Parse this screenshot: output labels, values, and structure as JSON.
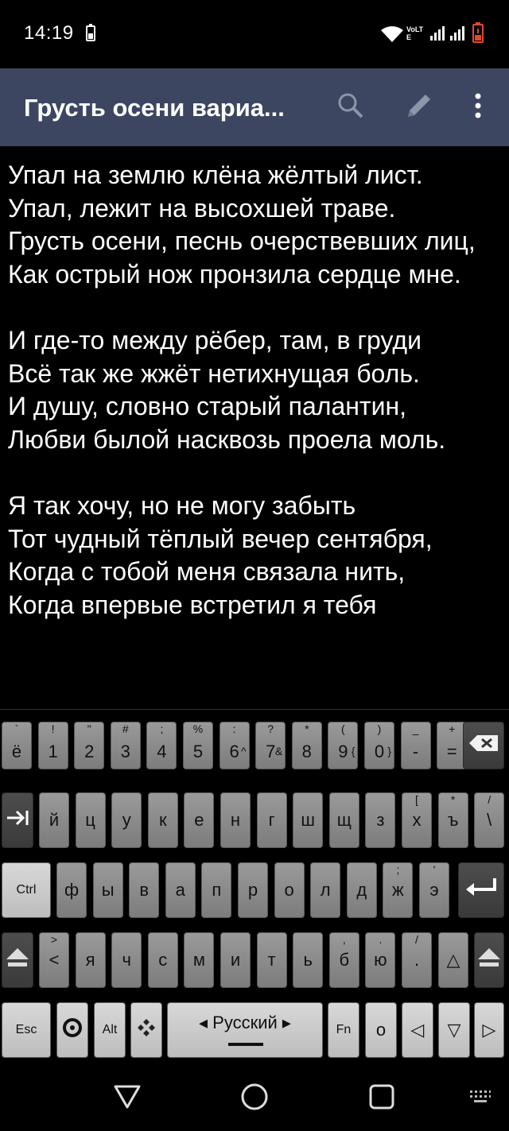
{
  "status": {
    "time": "14:19",
    "icons": [
      "battery-saver-icon",
      "wifi-icon",
      "volte-icon",
      "signal-icon",
      "signal-icon",
      "battery-low-icon"
    ],
    "volte_label": "VoLTE"
  },
  "app_bar": {
    "title": "Грусть осени вариа...",
    "actions": [
      "search-icon",
      "edit-icon",
      "more-vert-icon"
    ]
  },
  "poem": {
    "stanzas": [
      [
        "Упал на землю клёна жёлтый лист.",
        "Упал, лежит на высохшей траве.",
        "Грусть осени, песнь очерствевших лиц,",
        "Как острый нож пронзила сердце мне."
      ],
      [
        "И где-то между рёбер, там, в груди",
        "Всё так же жжёт нетихнущая боль.",
        "И душу, словно старый палантин,",
        "Любви былой насквозь проела моль."
      ],
      [
        "Я так хочу, но не могу забыть",
        "Тот чудный тёплый вечер сентября,",
        "Когда с тобой меня связала нить,",
        "Когда впервые встретил я тебя"
      ]
    ]
  },
  "keyboard": {
    "row1": [
      {
        "main": "ё",
        "hint": "`"
      },
      {
        "main": "1",
        "hint": "!"
      },
      {
        "main": "2",
        "hint": "\""
      },
      {
        "main": "3",
        "hint": "#"
      },
      {
        "main": "4",
        "hint": ";"
      },
      {
        "main": "5",
        "hint": "%"
      },
      {
        "main": "6",
        "hint": ":",
        "hint2": "^"
      },
      {
        "main": "7",
        "hint": "?",
        "hint2": "&"
      },
      {
        "main": "8",
        "hint": "*"
      },
      {
        "main": "9",
        "hint": "(",
        "hint2": "{"
      },
      {
        "main": "0",
        "hint": ")",
        "hint2": "}"
      },
      {
        "main": "-",
        "hint": "_"
      },
      {
        "main": "=",
        "hint": "+"
      }
    ],
    "row2": [
      "й",
      "ц",
      "у",
      "к",
      "е",
      "н",
      "г",
      "ш",
      "щ",
      "з",
      "х",
      "ъ",
      "\\"
    ],
    "row2_hints": {
      "х": "[",
      "ъ": "*",
      "\\": "/"
    },
    "row3": [
      "ф",
      "ы",
      "в",
      "а",
      "п",
      "р",
      "о",
      "л",
      "д",
      "ж",
      "э"
    ],
    "row3_hints": {
      "ж": ";",
      "э": "'"
    },
    "row4": [
      "<",
      "я",
      "ч",
      "с",
      "м",
      "и",
      "т",
      "ь",
      "б",
      "ю",
      "."
    ],
    "row4_hints": {
      "<": ">",
      "б": ",",
      "ю": ".",
      ".": "/"
    },
    "ctrl_label": "Ctrl",
    "esc_label": "Esc",
    "alt_label": "Alt",
    "fn_label": "Fn",
    "space_label": "◂ Русский ▸",
    "o_label": "о",
    "arrow_up": "△",
    "arrow_left": "◁",
    "arrow_down": "▽",
    "arrow_right": "▷",
    "backspace_icon": "backspace-icon",
    "tab_icon": "tab-icon",
    "enter_icon": "enter-icon",
    "shift_icon": "shift-icon",
    "settings_icon": "settings-icon",
    "diamond_icon": "diamond-icon"
  },
  "nav": {
    "buttons": [
      "back-icon",
      "home-icon",
      "recents-icon",
      "keyboard-switch-icon"
    ]
  },
  "colors": {
    "app_bar": "#3c4660",
    "background": "#000000",
    "key_gray": "#8a8a8a",
    "key_dark": "#444444",
    "key_light": "#cccccc",
    "battery_low": "#e24a2f"
  }
}
